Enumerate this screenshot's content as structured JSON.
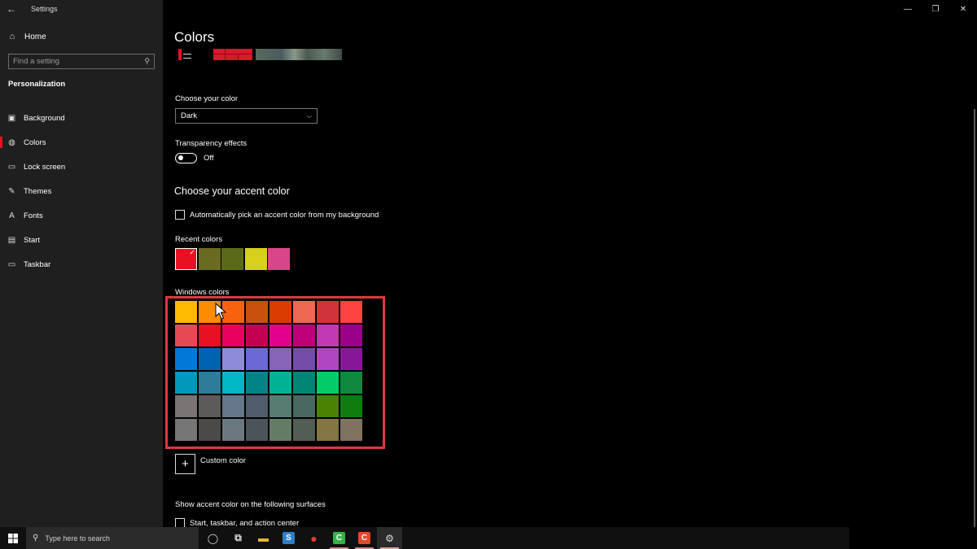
{
  "window": {
    "app_title": "Settings",
    "controls": [
      "—",
      "❐",
      "✕"
    ]
  },
  "sidebar": {
    "home_label": "Home",
    "search_placeholder": "Find a setting",
    "section_title": "Personalization",
    "items": [
      {
        "label": "Background",
        "icon": "image-icon",
        "glyph": "▣"
      },
      {
        "label": "Colors",
        "icon": "palette-icon",
        "glyph": "◍",
        "active": true
      },
      {
        "label": "Lock screen",
        "icon": "lock-screen-icon",
        "glyph": "▭"
      },
      {
        "label": "Themes",
        "icon": "themes-icon",
        "glyph": "✎"
      },
      {
        "label": "Fonts",
        "icon": "fonts-icon",
        "glyph": "A"
      },
      {
        "label": "Start",
        "icon": "start-icon",
        "glyph": "▤"
      },
      {
        "label": "Taskbar",
        "icon": "taskbar-icon",
        "glyph": "▭"
      }
    ]
  },
  "main": {
    "title": "Colors",
    "choose_color_label": "Choose your color",
    "choose_color_value": "Dark",
    "transparency_label": "Transparency effects",
    "transparency_state": "Off",
    "accent_heading": "Choose your accent color",
    "auto_pick_label": "Automatically pick an accent color from my background",
    "recent_label": "Recent colors",
    "recent_colors": [
      "#e81123",
      "#6b6b1f",
      "#5a6b17",
      "#d6d11c",
      "#d94589"
    ],
    "windows_colors_label": "Windows colors",
    "windows_colors": [
      "#ffb900",
      "#ff8c00",
      "#f7630c",
      "#ca5010",
      "#da3b01",
      "#ef6950",
      "#d13438",
      "#ff4343",
      "#e74856",
      "#e81123",
      "#ea005e",
      "#c30052",
      "#e3008c",
      "#bf0077",
      "#c239b3",
      "#9a0089",
      "#0078d7",
      "#0063b1",
      "#8e8cd8",
      "#6b69d6",
      "#8764b8",
      "#744da9",
      "#b146c2",
      "#881798",
      "#0099bc",
      "#2d7d9a",
      "#00b7c3",
      "#038387",
      "#00b294",
      "#018574",
      "#00cc6a",
      "#10893e",
      "#7a7574",
      "#5d5a58",
      "#68768a",
      "#515c6b",
      "#567c73",
      "#486860",
      "#498205",
      "#107c10",
      "#767676",
      "#4c4a48",
      "#69797e",
      "#4a5459",
      "#647c64",
      "#525e54",
      "#847545",
      "#7e735f"
    ],
    "custom_color_label": "Custom color",
    "surfaces_label": "Show accent color on the following surfaces",
    "surface_option": "Start, taskbar, and action center"
  },
  "taskbar": {
    "search_placeholder": "Type here to search",
    "apps": [
      {
        "name": "task-view-icon",
        "glyph": "◯"
      },
      {
        "name": "timeline-icon",
        "glyph": "⧉"
      },
      {
        "name": "file-explorer-icon",
        "glyph": "▬",
        "color": "#e8b83c"
      },
      {
        "name": "snagit-icon",
        "glyph": "S",
        "color": "#2e7ec9"
      },
      {
        "name": "chrome-icon",
        "glyph": "●",
        "color": "#e0412f"
      },
      {
        "name": "camtasia-icon",
        "glyph": "C",
        "color": "#35b34a",
        "running": true
      },
      {
        "name": "camtasia-recorder-icon",
        "glyph": "C",
        "color": "#e2492c",
        "running": true
      },
      {
        "name": "settings-gear-icon",
        "glyph": "⚙",
        "running": true,
        "active": true
      }
    ]
  }
}
